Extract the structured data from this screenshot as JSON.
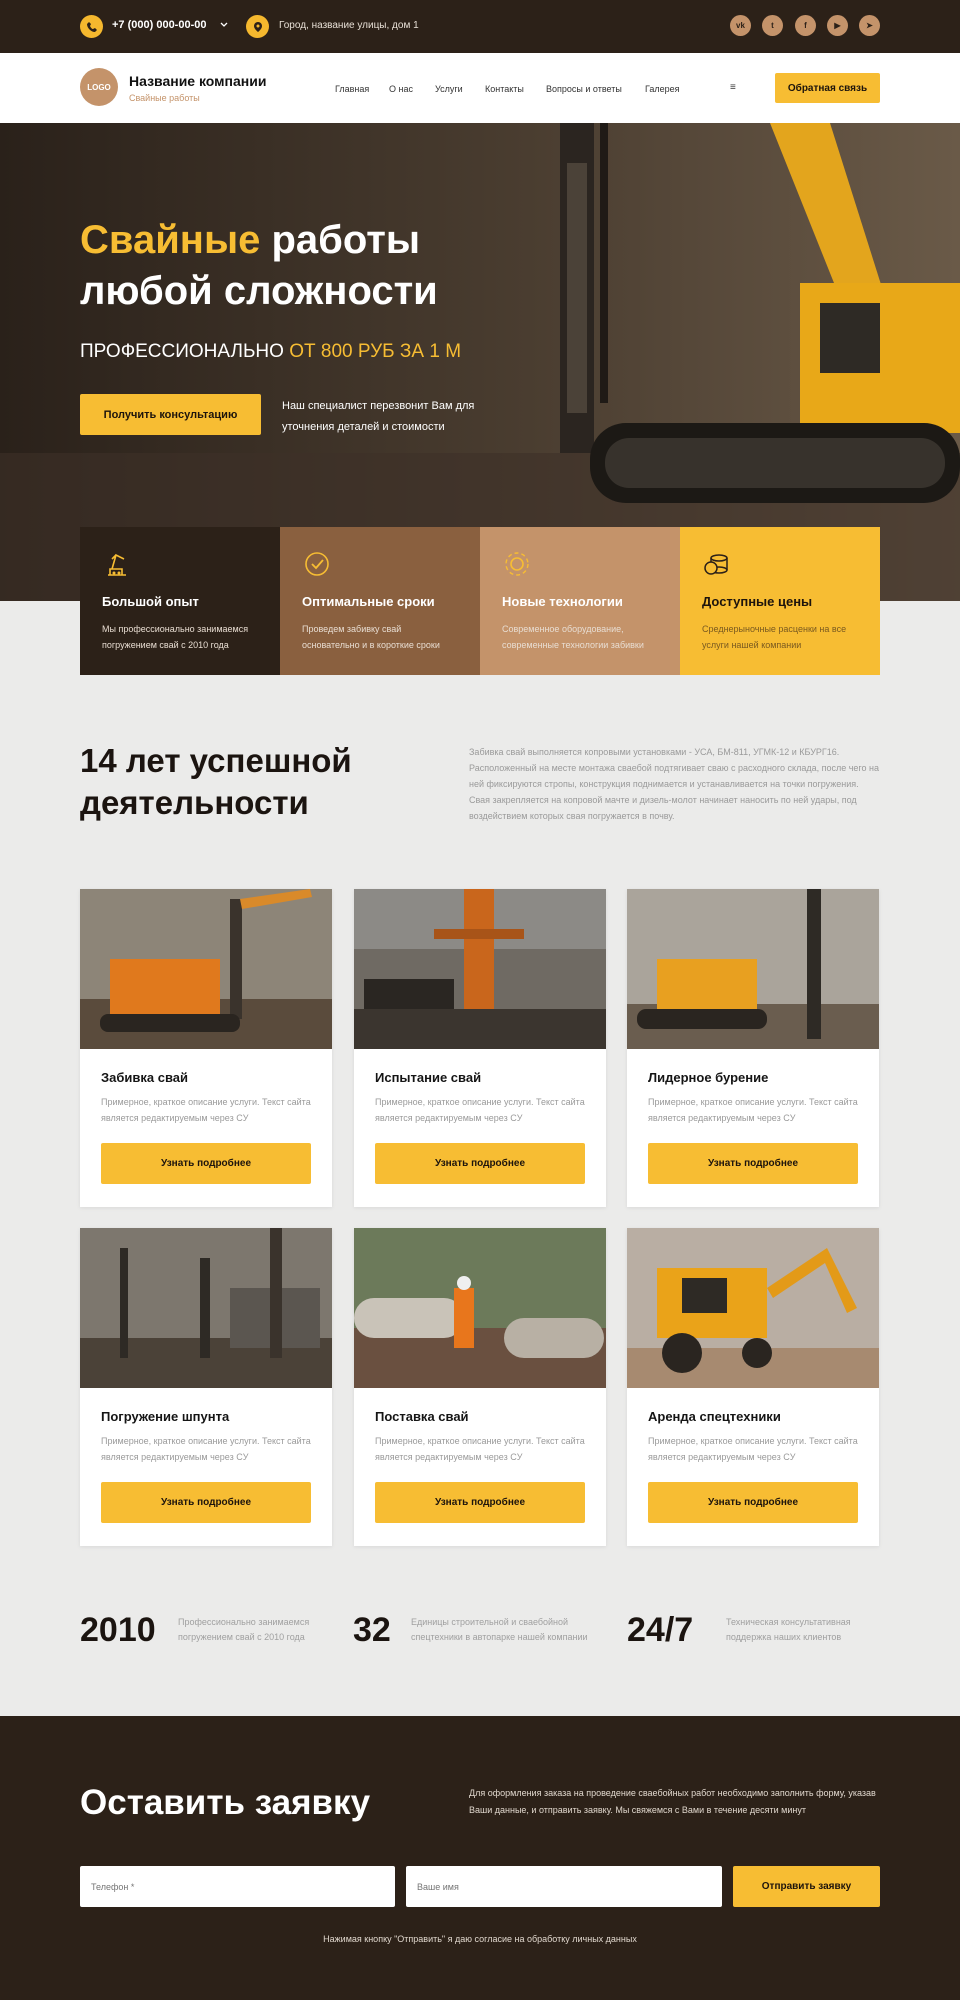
{
  "topbar": {
    "phone": "+7 (000) 000-00-00",
    "address": "Город, название улицы, дом 1",
    "social": [
      {
        "icon": "vk-icon",
        "glyph": "vk"
      },
      {
        "icon": "twitter-icon",
        "glyph": "t"
      },
      {
        "icon": "facebook-icon",
        "glyph": "f"
      },
      {
        "icon": "youtube-icon",
        "glyph": "▶"
      },
      {
        "icon": "telegram-icon",
        "glyph": "➤"
      }
    ]
  },
  "header": {
    "logo": "LOGO",
    "company_name": "Название компании",
    "company_sub": "Свайные работы",
    "nav": [
      "Главная",
      "О нас",
      "Услуги",
      "Контакты",
      "Вопросы и ответы",
      "Галерея"
    ],
    "menu_icon": "≡",
    "cta": "Обратная связь"
  },
  "hero": {
    "title_accent": "Свайные",
    "title_rest": " работы любой сложности",
    "sub_main": "ПРОФЕССИОНАЛЬНО ",
    "sub_accent": "ОТ 800 РУБ ЗА 1 М",
    "button": "Получить консультацию",
    "note": "Наш специалист перезвонит Вам для уточнения деталей и стоимости"
  },
  "features": [
    {
      "icon": "crane-icon",
      "title": "Большой опыт",
      "text": "Мы профессионально занимаемся погружением свай с 2010 года",
      "bg": "#2c2118"
    },
    {
      "icon": "clock-check-icon",
      "title": "Оптимальные сроки",
      "text": "Проведем забивку свай основательно и в короткие сроки",
      "bg": "#8a603f"
    },
    {
      "icon": "gear-icon",
      "title": "Новые технологии",
      "text": "Современное оборудование, современные технологии забивки",
      "bg": "#c4936a"
    },
    {
      "icon": "coins-icon",
      "title": "Доступные цены",
      "text": "Среднерыночные расценки на все услуги нашей компании",
      "bg": "#f7bd33"
    }
  ],
  "about": {
    "title": "14 лет успешной деятельности",
    "text": "Забивка свай выполняется копровыми установками - УСА, БМ-811, УГМК-12 и КБУРГ16. Расположенный на месте монтажа сваебой подтягивает сваю с расходного склада, после чего на ней фиксируются стропы, конструкция поднимается и устанавливается на точки погружения. Свая закрепляется на копровой мачте и дизель-молот начинает наносить по ней удары, под воздействием которых свая погружается в почву."
  },
  "services": [
    {
      "title": "Забивка свай",
      "desc": "Примерное, краткое описание услуги. Текст сайта является редактируемым через CУ",
      "button": "Узнать подробнее"
    },
    {
      "title": "Испытание свай",
      "desc": "Примерное, краткое описание услуги. Текст сайта является редактируемым через CУ",
      "button": "Узнать подробнее"
    },
    {
      "title": "Лидерное бурение",
      "desc": "Примерное, краткое описание услуги. Текст сайта является редактируемым через CУ",
      "button": "Узнать подробнее"
    },
    {
      "title": "Погружение шпунта",
      "desc": "Примерное, краткое описание услуги. Текст сайта является редактируемым через CУ",
      "button": "Узнать подробнее"
    },
    {
      "title": "Поставка свай",
      "desc": "Примерное, краткое описание услуги. Текст сайта является редактируемым через CУ",
      "button": "Узнать подробнее"
    },
    {
      "title": "Аренда спецтехники",
      "desc": "Примерное, краткое описание услуги. Текст сайта является редактируемым через CУ",
      "button": "Узнать подробнее"
    }
  ],
  "stats": [
    {
      "number": "2010",
      "text": "Профессионально занимаемся погружением свай с 2010 года"
    },
    {
      "number": "32",
      "text": "Единицы строительной и сваебойной спецтехники в автопарке нашей компании"
    },
    {
      "number": "24/7",
      "text": "Техническая консультативная поддержка наших клиентов"
    }
  ],
  "request": {
    "title": "Оставить заявку",
    "text": "Для оформления заказа на проведение сваебойных работ необходимо заполнить форму, указав Ваши данные, и отправить заявку. Мы свяжемся с Вами в течение десяти минут",
    "phone_placeholder": "Телефон *",
    "name_placeholder": "Ваше имя",
    "button": "Отправить заявку",
    "agreement": "Нажимая кнопку \"Отправить\" я даю согласие на обработку личных данных"
  },
  "colors": {
    "accent": "#f7bd33",
    "dark": "#2c2118",
    "brown": "#8a603f",
    "tan": "#c4936a"
  }
}
